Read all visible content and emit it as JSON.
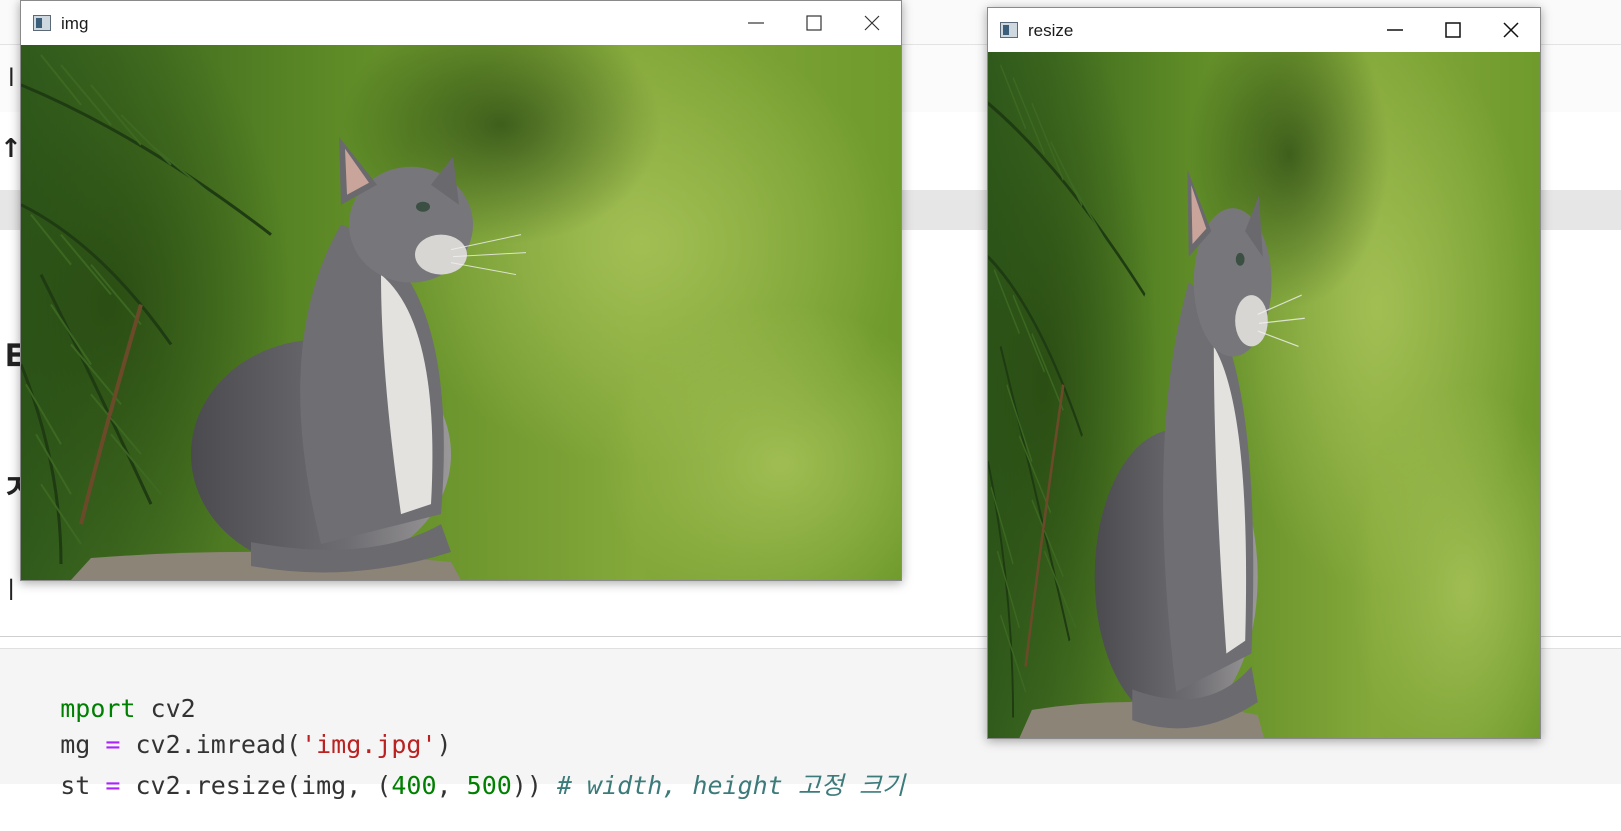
{
  "windows": {
    "img": {
      "title": "img",
      "icons": {
        "app": "opencv-window-icon",
        "minimize": "minimize-icon",
        "maximize": "maximize-icon",
        "close": "close-icon"
      }
    },
    "resize": {
      "title": "resize",
      "icons": {
        "app": "opencv-window-icon",
        "minimize": "minimize-icon",
        "maximize": "maximize-icon",
        "close": "close-icon"
      }
    }
  },
  "image_content": "kitten-looking-up-photo",
  "code_cell": {
    "line1": {
      "kw": "mport",
      "rest": " cv2"
    },
    "line2": {
      "a": "mg ",
      "op": "=",
      "b": " cv2.imread(",
      "str": "'img.jpg'",
      "c": ")"
    },
    "line3": {
      "a": "st ",
      "op": "=",
      "b": " cv2.resize(img, (",
      "n1": "400",
      "sep": ", ",
      "n2": "500",
      "c": ")) ",
      "comment": "# width, height 고정 크기"
    }
  },
  "background_fragments": {
    "frag1": "l",
    "frag2": "↑",
    "frag3": "ㅌ",
    "frag4": "ㅈ",
    "frag5": "ㅣ"
  },
  "colors": {
    "keyword": "#008000",
    "operator": "#aa22ff",
    "string": "#ba2121",
    "number": "#008000",
    "comment": "#3d7b7b"
  }
}
